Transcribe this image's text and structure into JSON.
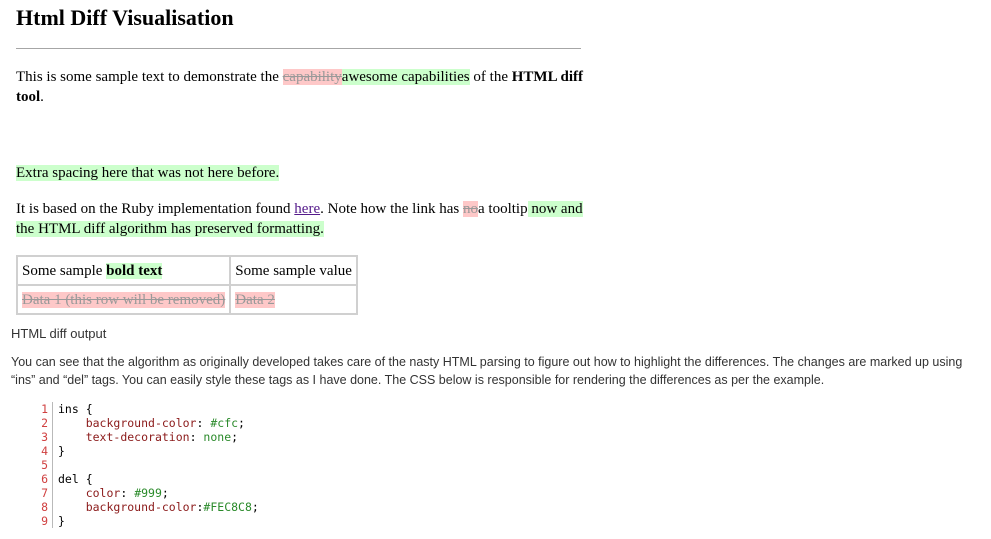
{
  "heading": "Html Diff Visualisation",
  "paragraph1": {
    "t1": "This is some sample text to demonstrate the ",
    "del": "capability",
    "ins": "awesome capabilities",
    "t2": " of the ",
    "bold": "HTML diff tool",
    "t3": "."
  },
  "paragraph2": {
    "ins": "Extra spacing here that was not here before."
  },
  "paragraph3": {
    "t1": "It is based on the Ruby implementation found ",
    "link": "here",
    "t2": ". Note how the link has ",
    "del": "no",
    "t3": "a tooltip",
    "ins": " now and the HTML diff algorithm has preserved formatting."
  },
  "table": {
    "row1": {
      "c1_t": "Some sample ",
      "c1_ins": "bold text",
      "c2": "Some sample value"
    },
    "row2": {
      "c1": "Data 1 (this row will be removed)",
      "c2": "Data 2"
    }
  },
  "output_label": "HTML diff output",
  "description": "You can see that the algorithm as originally developed takes care of the nasty HTML parsing to figure out how to highlight the differences. The changes are marked up using “ins” and “del” tags. You can easily style these tags as I have done. The CSS below is responsible for rendering the differences as per the example.",
  "code": {
    "line_numbers": [
      "1",
      "2",
      "3",
      "4",
      "5",
      "6",
      "7",
      "8",
      "9"
    ],
    "l1_selector": "ins",
    "l1_brace": " {",
    "l2_prop": "background-color",
    "l2_value": "#cfc",
    "l3_prop": "text-decoration",
    "l3_value": "none",
    "l4_brace": "}",
    "l6_selector": "del",
    "l6_brace": " {",
    "l7_prop": "color",
    "l7_value": "#999",
    "l8_prop": "background-color",
    "l8_value": "#FEC8C8",
    "l9_brace": "}"
  }
}
